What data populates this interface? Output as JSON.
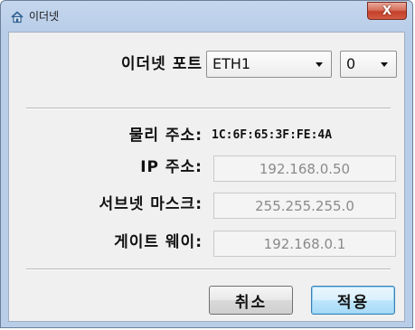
{
  "window": {
    "title": "이더넷",
    "close_label": "X",
    "icon": "house-network-icon"
  },
  "port": {
    "label": "이더넷 포트",
    "port_value": "ETH1",
    "index_value": "0"
  },
  "mac": {
    "label": "물리 주소:",
    "value": "1C:6F:65:3F:FE:4A"
  },
  "ip": {
    "label": "IP 주소:",
    "value": "192.168.0.50"
  },
  "subnet": {
    "label": "서브넷 마스크:",
    "value": "255.255.255.0"
  },
  "gateway": {
    "label": "게이트 웨이:",
    "value": "192.168.0.1"
  },
  "buttons": {
    "cancel": "취소",
    "apply": "적용"
  },
  "colors": {
    "titlebar": "#b8cde8",
    "client": "#f0f0f0",
    "close": "#c4402a",
    "primary_border": "#3c7fb1"
  }
}
